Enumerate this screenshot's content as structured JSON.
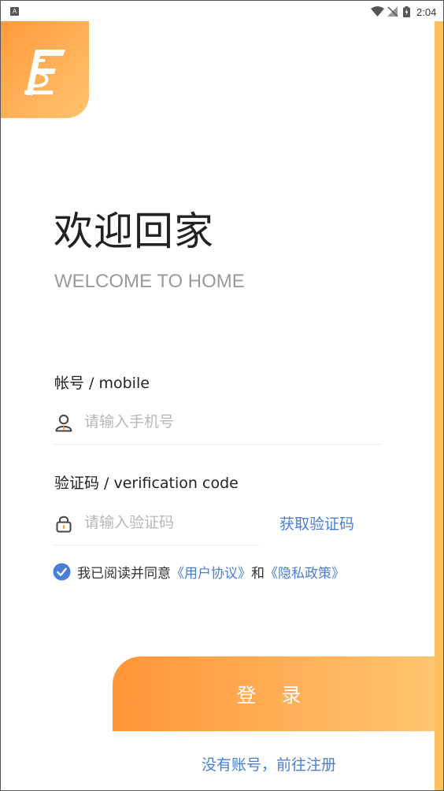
{
  "status_bar": {
    "notification_icon": "A",
    "time": "2:04",
    "icons": [
      "wifi-icon",
      "no-signal-icon",
      "battery-charging-icon"
    ]
  },
  "colors": {
    "accent_start": "#ff9538",
    "accent_end": "#ffc56f",
    "link": "#4a7ed6",
    "title": "#222222",
    "subtitle": "#9a9a9a",
    "placeholder": "#b8b8b8"
  },
  "logo": {
    "icon": "app-logo-icon"
  },
  "header": {
    "title": "欢迎回家",
    "subtitle": "WELCOME TO HOME"
  },
  "form": {
    "account": {
      "label": "帐号 / mobile",
      "placeholder": "请输入手机号",
      "value": "",
      "icon": "user-icon"
    },
    "code": {
      "label": "验证码 / verification code",
      "placeholder": "请输入验证码",
      "value": "",
      "icon": "lock-icon",
      "get_code_label": "获取验证码"
    },
    "agreement": {
      "checked": true,
      "prefix": "我已阅读并同意",
      "user_agreement": "《用户协议》",
      "connector": "和",
      "privacy_policy": "《隐私政策》"
    },
    "login_label": "登 录",
    "register_label": "没有账号，前往注册"
  }
}
